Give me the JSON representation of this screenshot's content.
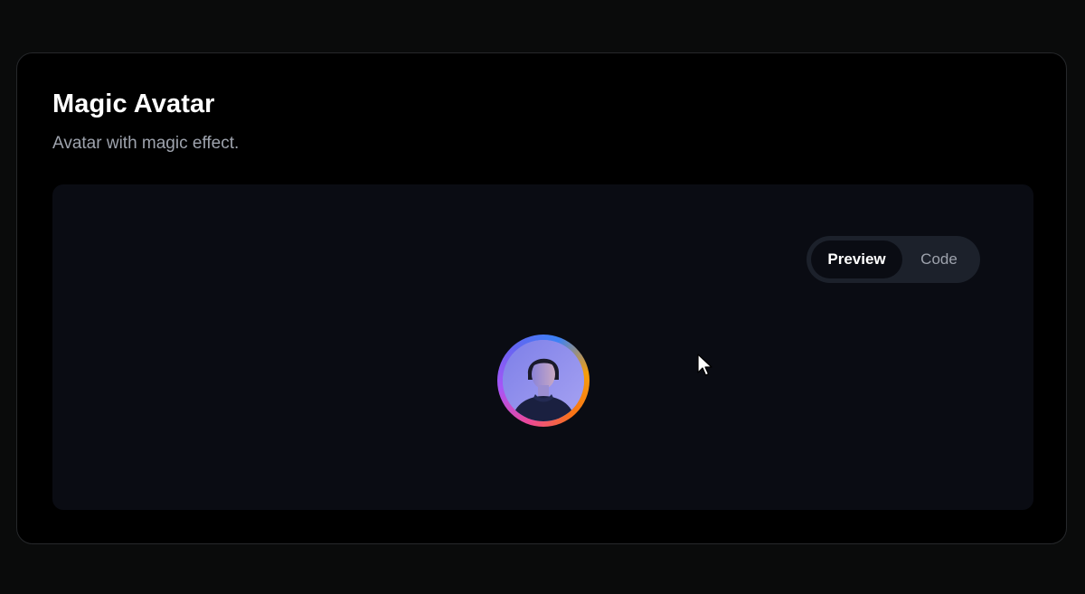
{
  "component": {
    "title": "Magic Avatar",
    "description": "Avatar with magic effect."
  },
  "toggle": {
    "preview_label": "Preview",
    "code_label": "Code",
    "selected": "Preview"
  },
  "avatar": {
    "ring_colors": [
      "#ec4899",
      "#a855f7",
      "#6366f1",
      "#3b82f6",
      "#f59e0b",
      "#f97316"
    ]
  },
  "colors": {
    "page_background": "#0a0b0b",
    "card_background": "#000000",
    "preview_background": "#0a0c13",
    "toggle_background": "#1c212b",
    "muted_text": "#9ea3ad"
  }
}
